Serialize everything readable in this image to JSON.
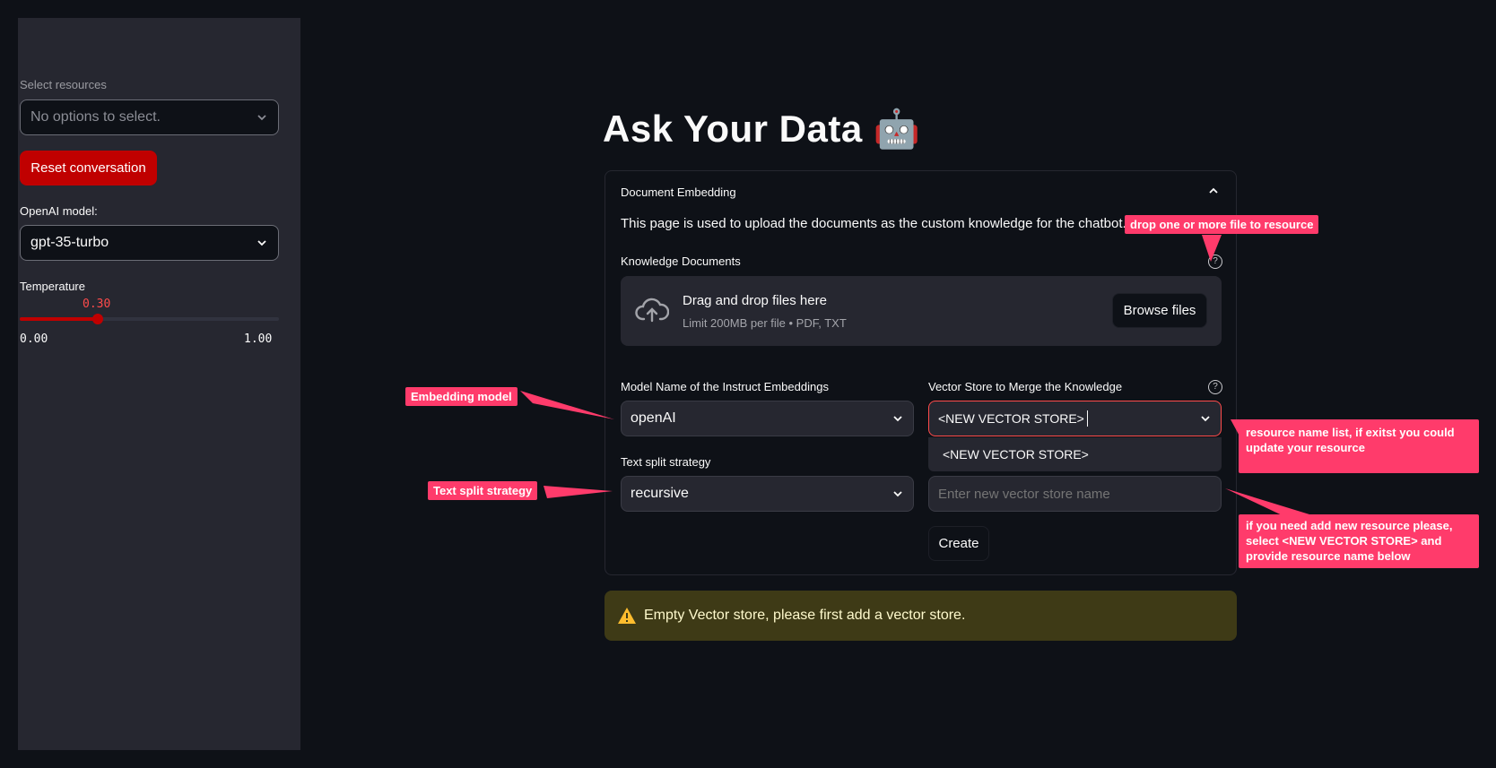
{
  "sidebar": {
    "resources_label": "Select resources",
    "resources_placeholder": "No options to select.",
    "reset_button": "Reset conversation",
    "model_label": "OpenAI model:",
    "model_value": "gpt-35-turbo",
    "temperature_label": "Temperature",
    "temperature_value": "0.30",
    "temperature_fraction": 0.3,
    "temperature_min": "0.00",
    "temperature_max": "1.00"
  },
  "main": {
    "title": "Ask Your Data 🤖",
    "expander_title": "Document Embedding",
    "description": "This page is used to upload the documents as the custom knowledge for the chatbot.",
    "knowledge_label": "Knowledge Documents",
    "drop_title": "Drag and drop files here",
    "drop_sub": "Limit 200MB per file • PDF, TXT",
    "browse_button": "Browse files",
    "model_name_label": "Model Name of the Instruct Embeddings",
    "model_name_value": "openAI",
    "vector_store_label": "Vector Store to Merge the Knowledge",
    "vector_store_value": "<NEW VECTOR STORE>",
    "vector_store_option": "<NEW VECTOR STORE>",
    "split_label": "Text split strategy",
    "split_value": "recursive",
    "new_store_placeholder": "Enter new vector store name",
    "create_button": "Create",
    "warning": "Empty Vector store, please first add a vector store."
  },
  "annotations": {
    "drop": "drop one or more file to resource",
    "embedding": "Embedding model",
    "split": "Text split strategy",
    "resource_list": "resource name list, if exitst you could update your resource",
    "new_resource": "if you need add new resource please, select <NEW VECTOR STORE> and provide resource name below"
  },
  "colors": {
    "accent_red": "#ff4b4b",
    "button_red": "#c00000",
    "annotation_pink": "#ff3b6b",
    "background": "#0e1117",
    "sidebar": "#262730"
  }
}
